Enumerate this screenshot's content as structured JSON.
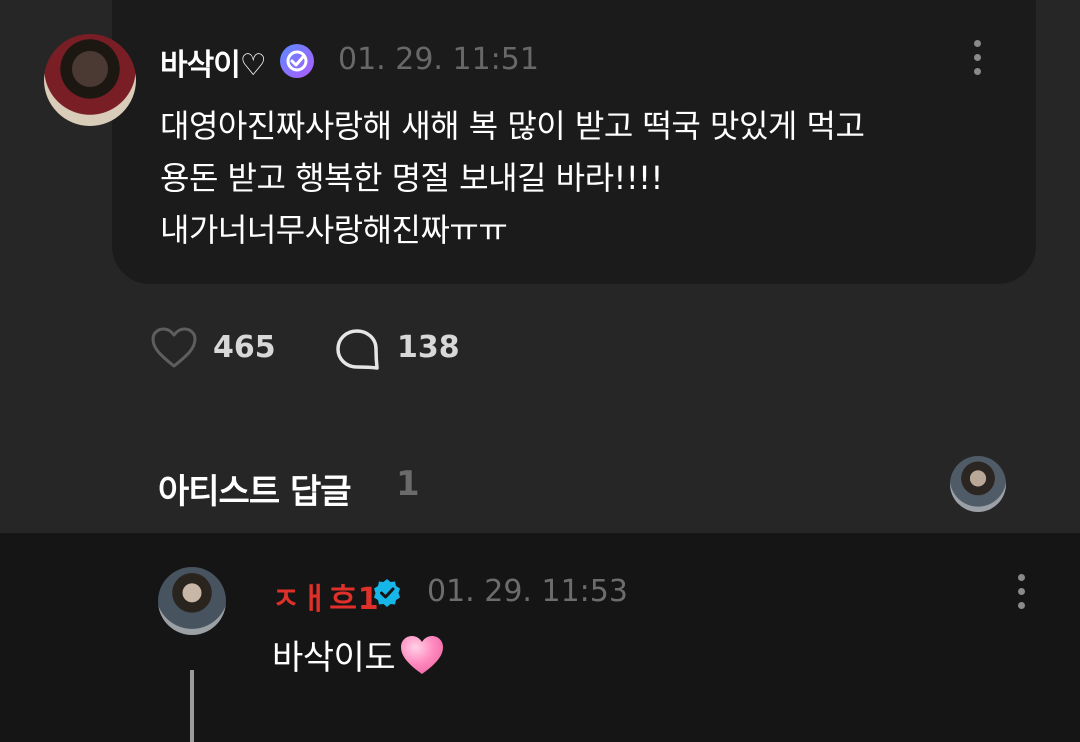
{
  "post": {
    "author": "바삭이♡",
    "badge_icon": "verified-purple-icon",
    "timestamp": "01. 29. 11:51",
    "body_lines": [
      "대영아진짜사랑해 새해 복 많이 받고 떡국 맛있게 먹고",
      "용돈 받고 행복한 명절 보내길 바라!!!!",
      "내가너너무사랑해진짜ㅠㅠ"
    ],
    "like_count": "465",
    "comment_count": "138"
  },
  "artist_replies": {
    "title": "아티스트 답글",
    "count": "1"
  },
  "reply": {
    "author": "ㅈㅐ흐1",
    "badge_icon": "verified-blue-icon",
    "timestamp": "01. 29. 11:53",
    "body": "바삭이도",
    "emoji": "pink-heart-emoji"
  },
  "colors": {
    "background": "#262626",
    "card": "#1b1b1b",
    "reply_background": "#151515",
    "reply_name": "#e0302a",
    "timestamp": "#686868",
    "verified_blue": "#16b7e8"
  }
}
